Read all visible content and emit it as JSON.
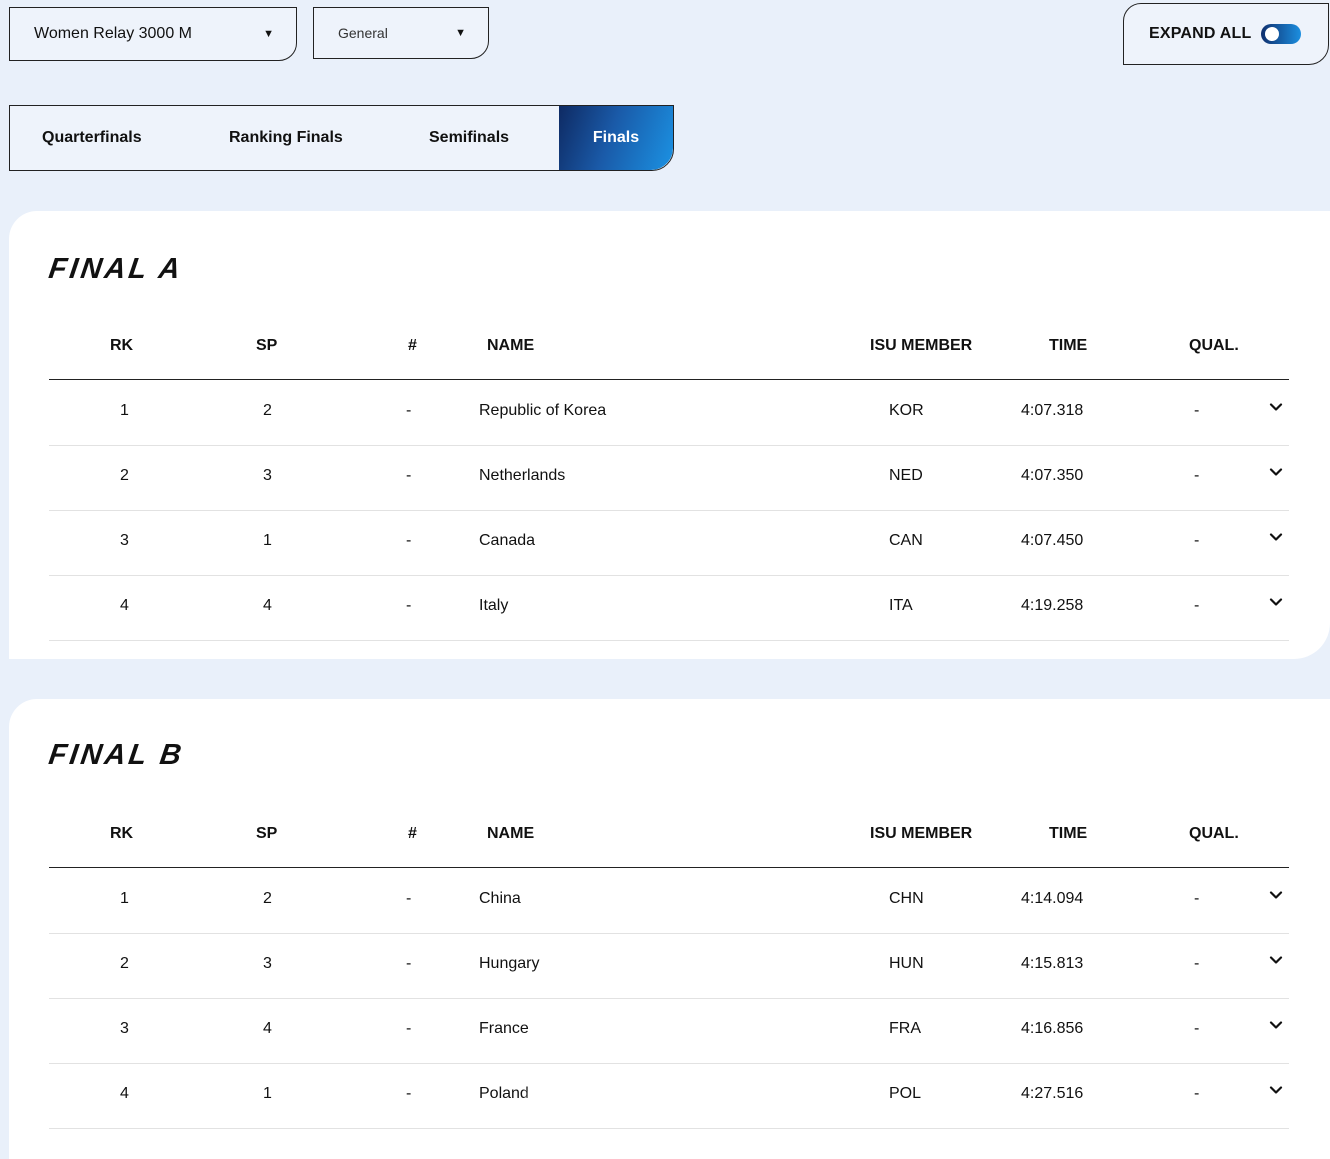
{
  "filters": {
    "event": "Women Relay 3000 M",
    "classification": "General"
  },
  "expand_all": {
    "label": "EXPAND ALL",
    "state": "off"
  },
  "tabs": [
    {
      "label": "Quarterfinals",
      "active": false
    },
    {
      "label": "Ranking Finals",
      "active": false
    },
    {
      "label": "Semifinals",
      "active": false
    },
    {
      "label": "Finals",
      "active": true
    }
  ],
  "columns": {
    "rk": "RK",
    "sp": "SP",
    "num": "#",
    "name": "NAME",
    "member": "ISU MEMBER",
    "time": "TIME",
    "qual": "QUAL."
  },
  "finals": [
    {
      "title": "FINAL A",
      "rows": [
        {
          "rk": "1",
          "sp": "2",
          "num": "-",
          "name": "Republic of Korea",
          "member": "KOR",
          "time": "4:07.318",
          "qual": "-"
        },
        {
          "rk": "2",
          "sp": "3",
          "num": "-",
          "name": "Netherlands",
          "member": "NED",
          "time": "4:07.350",
          "qual": "-"
        },
        {
          "rk": "3",
          "sp": "1",
          "num": "-",
          "name": "Canada",
          "member": "CAN",
          "time": "4:07.450",
          "qual": "-"
        },
        {
          "rk": "4",
          "sp": "4",
          "num": "-",
          "name": "Italy",
          "member": "ITA",
          "time": "4:19.258",
          "qual": "-"
        }
      ]
    },
    {
      "title": "FINAL B",
      "rows": [
        {
          "rk": "1",
          "sp": "2",
          "num": "-",
          "name": "China",
          "member": "CHN",
          "time": "4:14.094",
          "qual": "-"
        },
        {
          "rk": "2",
          "sp": "3",
          "num": "-",
          "name": "Hungary",
          "member": "HUN",
          "time": "4:15.813",
          "qual": "-"
        },
        {
          "rk": "3",
          "sp": "4",
          "num": "-",
          "name": "France",
          "member": "FRA",
          "time": "4:16.856",
          "qual": "-"
        },
        {
          "rk": "4",
          "sp": "1",
          "num": "-",
          "name": "Poland",
          "member": "POL",
          "time": "4:27.516",
          "qual": "-"
        }
      ]
    }
  ],
  "icons": {
    "dropdown": "caret-down-icon",
    "row_expand": "chevron-down-icon"
  }
}
